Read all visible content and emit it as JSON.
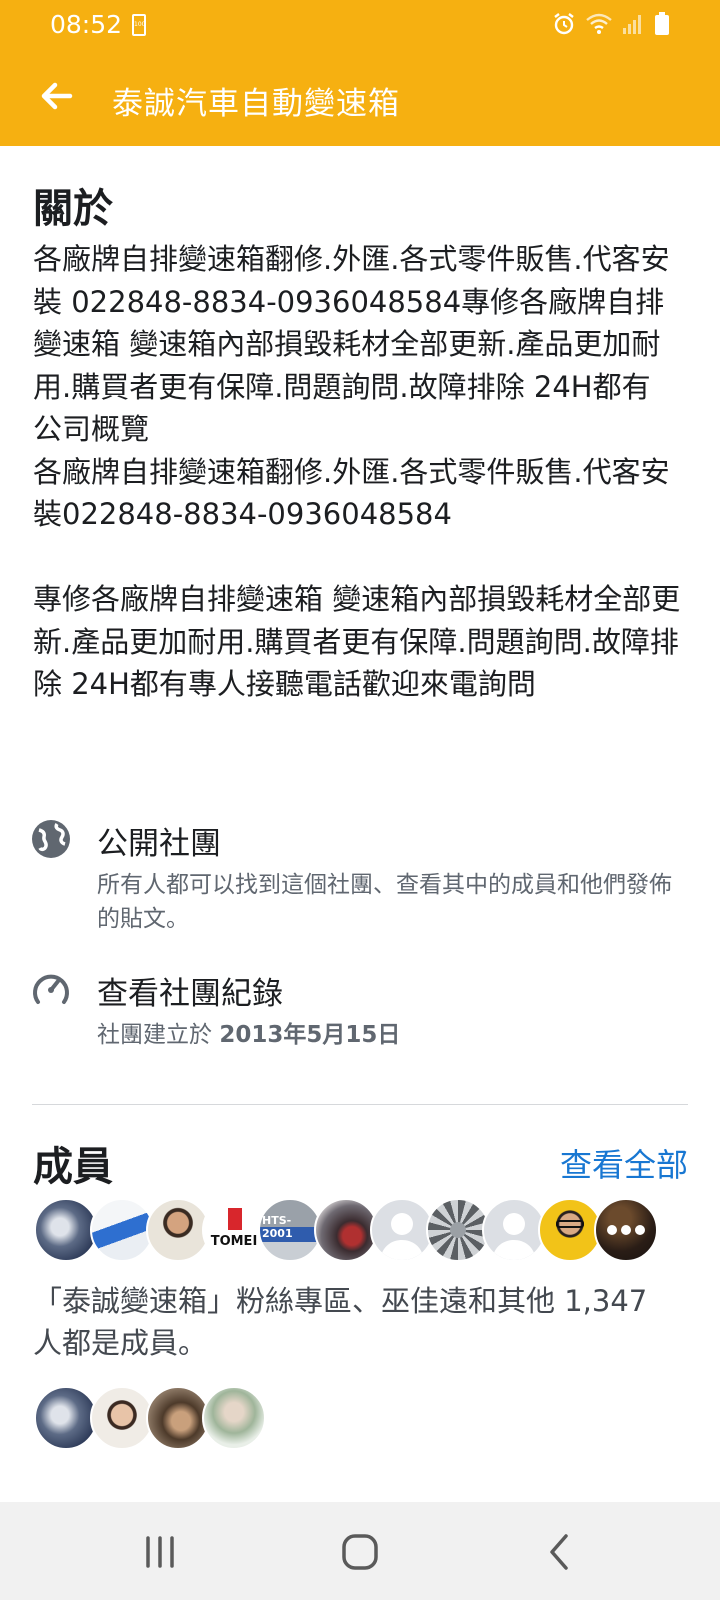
{
  "status_bar": {
    "time": "08:52",
    "battery_small_label": "100"
  },
  "app_bar": {
    "title": "泰誠汽車自動變速箱"
  },
  "about": {
    "heading": "關於",
    "description": "各廠牌自排變速箱翻修.外匯.各式零件販售.代客安裝 022848-8834-0936048584專修各廠牌自排變速箱 變速箱內部損毀耗材全部更新.產品更加耐用.購買者更有保障.問題詢問.故障排除 24H都有\n公司概覽\n各廠牌自排變速箱翻修.外匯.各式零件販售.代客安裝022848-8834-0936048584\n\n專修各廠牌自排變速箱 變速箱內部損毀耗材全部更新.產品更加耐用.購買者更有保障.問題詢問.故障排除 24H都有專人接聽電話歡迎來電詢問"
  },
  "public_group": {
    "title": "公開社團",
    "subtitle": "所有人都可以找到這個社團、查看其中的成員和他們發佈的貼文。"
  },
  "history": {
    "title": "查看社團紀錄",
    "subtitle_prefix": "社團建立於 ",
    "date": "2013年5月15日"
  },
  "members": {
    "heading": "成員",
    "see_all": "查看全部",
    "summary": "「泰誠變速箱」粉絲專區、巫佳遠和其他 1,347人都是成員。",
    "avatar_label_tomei": "TOMEI",
    "avatar_label_hts": "HTS-2001"
  },
  "colors": {
    "accent": "#f6b011",
    "link": "#1877d2"
  }
}
